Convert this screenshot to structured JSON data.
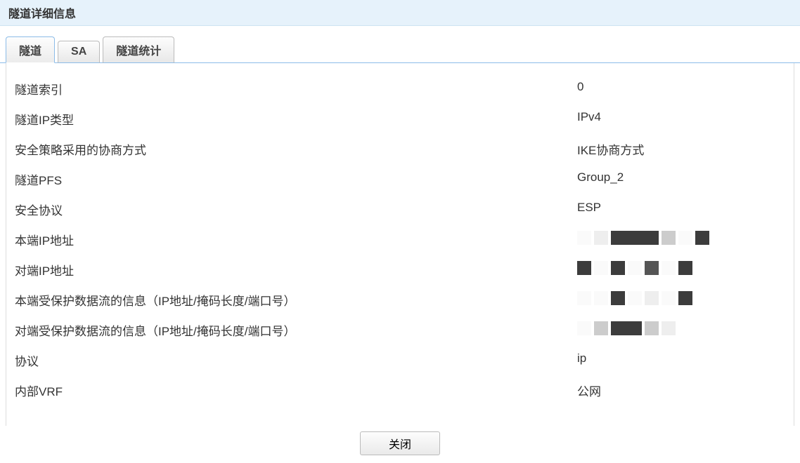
{
  "header": {
    "title": "隧道详细信息"
  },
  "tabs": [
    {
      "label": "隧道",
      "active": true
    },
    {
      "label": "SA",
      "active": false
    },
    {
      "label": "隧道统计",
      "active": false
    }
  ],
  "rows": [
    {
      "label": "隧道索引",
      "value": "0"
    },
    {
      "label": "隧道IP类型",
      "value": "IPv4"
    },
    {
      "label": "安全策略采用的协商方式",
      "value": "IKE协商方式"
    },
    {
      "label": "隧道PFS",
      "value": "Group_2"
    },
    {
      "label": "安全协议",
      "value": "ESP"
    },
    {
      "label": "本端IP地址",
      "value": ""
    },
    {
      "label": "对端IP地址",
      "value": ""
    },
    {
      "label": "本端受保护数据流的信息（IP地址/掩码长度/端口号）",
      "value": ""
    },
    {
      "label": "对端受保护数据流的信息（IP地址/掩码长度/端口号）",
      "value": ""
    },
    {
      "label": "协议",
      "value": "ip"
    },
    {
      "label": "内部VRF",
      "value": "公网"
    }
  ],
  "footer": {
    "close_button": "关闭"
  }
}
